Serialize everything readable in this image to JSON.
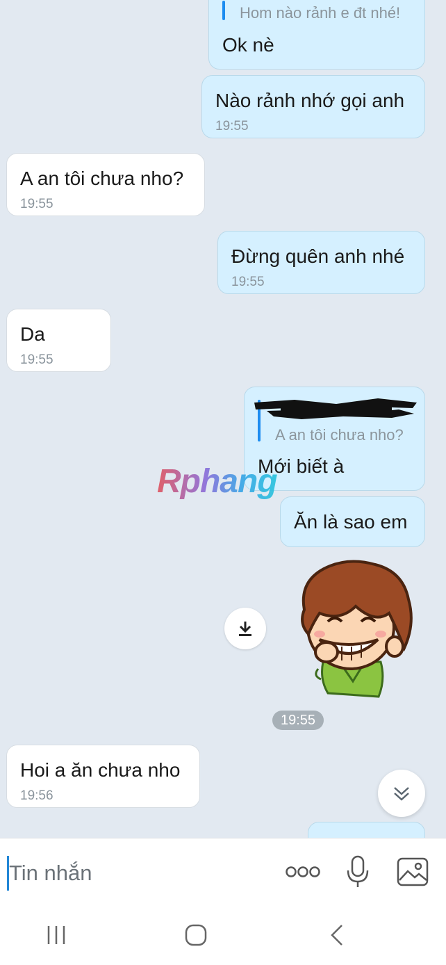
{
  "messages": [
    {
      "id": "m1",
      "quote": "Hom nào rảnh e đt nhé!",
      "text": "Ok nè"
    },
    {
      "id": "m2",
      "text": "Nào rảnh nhớ gọi anh",
      "time": "19:55"
    },
    {
      "id": "m3",
      "text": "A an tôi chưa nho?",
      "time": "19:55"
    },
    {
      "id": "m4",
      "text": "Đừng quên anh nhé",
      "time": "19:55"
    },
    {
      "id": "m5",
      "text": "Da",
      "time": "19:55"
    },
    {
      "id": "m6",
      "quote": "A an tôi chưa nho?",
      "text": "Mới biết à"
    },
    {
      "id": "m7",
      "text": "Ăn là sao em"
    },
    {
      "id": "m9",
      "text": "Hoi a ăn chưa nho",
      "time": "19:56"
    }
  ],
  "sticker_time": "19:55",
  "watermark": "Rphang",
  "input": {
    "placeholder": "Tin nhắn"
  },
  "icons": {
    "download": "download-icon",
    "scroll_down": "chevron-double-down-icon",
    "more": "more-options-icon",
    "mic": "microphone-icon",
    "gallery": "image-icon",
    "nav_recent": "recent-apps-icon",
    "nav_home": "home-icon",
    "nav_back": "back-icon"
  },
  "colors": {
    "chat_background": "#e2e9f1",
    "outgoing_bubble": "#d5f0ff",
    "incoming_bubble": "#ffffff",
    "quote_bar": "#1c8cf0",
    "cursor": "#2387d6"
  }
}
